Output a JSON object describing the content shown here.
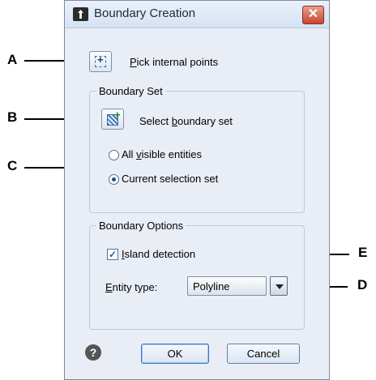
{
  "dialog": {
    "title": "Boundary Creation",
    "close_label": "✕",
    "pick_points": {
      "pre": "",
      "ul": "P",
      "post": "ick internal points"
    },
    "boundary_set": {
      "legend": "Boundary Set",
      "select_set": {
        "pre": "Select ",
        "ul": "b",
        "post": "oundary set"
      },
      "options": [
        {
          "pre": "All ",
          "ul": "v",
          "post": "isible entities",
          "selected": false
        },
        {
          "pre": "Current selection set",
          "ul": "",
          "post": "",
          "selected": true
        }
      ]
    },
    "boundary_options": {
      "legend": "Boundary Options",
      "island": {
        "pre": "",
        "ul": "I",
        "post": "sland detection",
        "checked": true,
        "check_glyph": "✓"
      },
      "entity_type": {
        "pre": "",
        "ul": "E",
        "post": "ntity type:",
        "value": "Polyline"
      }
    },
    "help_glyph": "?",
    "ok_label": "OK",
    "cancel_label": "Cancel"
  },
  "callouts": {
    "a": "A",
    "b": "B",
    "c": "C",
    "d": "D",
    "e": "E"
  }
}
